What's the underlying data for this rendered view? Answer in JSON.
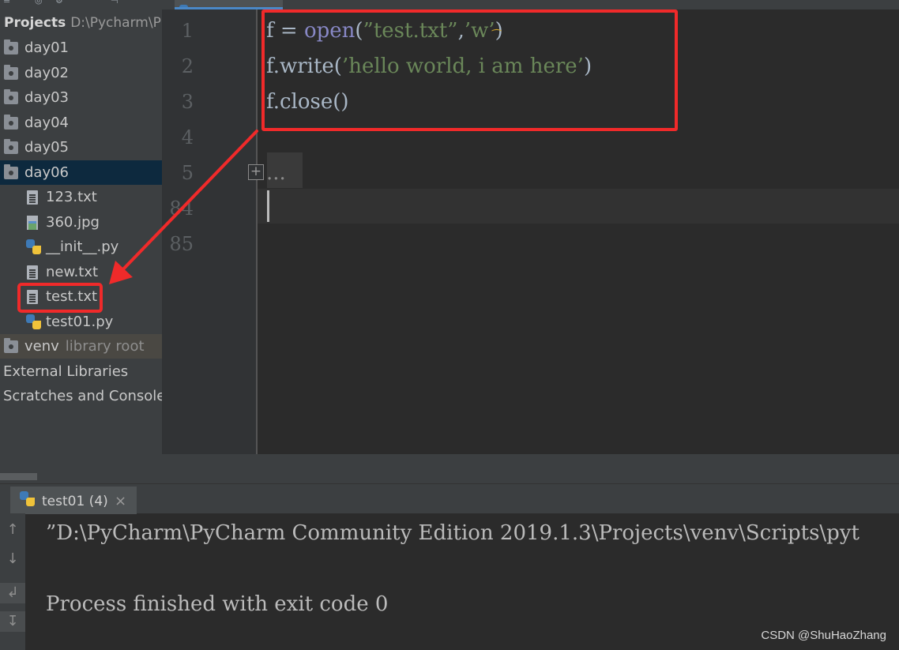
{
  "sidebar": {
    "title": "Projects",
    "path": "D:\\Pycharm\\Pr",
    "items": [
      {
        "label": "day01",
        "icon": "folder-icon"
      },
      {
        "label": "day02",
        "icon": "folder-icon"
      },
      {
        "label": "day03",
        "icon": "folder-icon"
      },
      {
        "label": "day04",
        "icon": "folder-icon"
      },
      {
        "label": "day05",
        "icon": "folder-icon"
      },
      {
        "label": "day06",
        "icon": "folder-icon"
      },
      {
        "label": "123.txt",
        "icon": "text-file-icon"
      },
      {
        "label": "360.jpg",
        "icon": "image-file-icon"
      },
      {
        "label": "__init__.py",
        "icon": "python-file-icon"
      },
      {
        "label": "new.txt",
        "icon": "text-file-icon"
      },
      {
        "label": "test.txt",
        "icon": "text-file-icon"
      },
      {
        "label": "test01.py",
        "icon": "python-file-icon"
      },
      {
        "label": "venv",
        "icon": "folder-icon",
        "hint": "library root"
      },
      {
        "label": "External Libraries"
      },
      {
        "label": "Scratches and Consoles"
      }
    ]
  },
  "editor": {
    "line_numbers": [
      "1",
      "2",
      "3",
      "4",
      "5",
      "84",
      "85"
    ],
    "code": {
      "line1": {
        "t1": "f = ",
        "t2": "open",
        "t3": "(",
        "t4": "”test.txt”",
        "t5": ",",
        "t6": "’w’",
        "t7": ")"
      },
      "line2": {
        "t1": "f.write(",
        "t2": "’hello world, i am here’",
        "t3": ")"
      },
      "line3": {
        "t1": "f.close()"
      },
      "folded": "..."
    },
    "fold_toggle": "+"
  },
  "run_panel": {
    "tab_label": "test01 (4)",
    "close_glyph": "×",
    "console_lines": [
      "”D:\\PyCharm\\PyCharm Community Edition 2019.1.3\\Projects\\venv\\Scripts\\pyt",
      "Process finished with exit code 0"
    ],
    "tools": {
      "up": "↑",
      "down": "↓",
      "soft_wrap": "↲",
      "scroll_end": "↧"
    }
  },
  "watermark": "CSDN @ShuHaoZhang",
  "colors": {
    "annotation_red": "#f02a2a",
    "selection_blue": "#0d293e",
    "string_green": "#6a8759",
    "builtin_purple": "#8888c6"
  }
}
